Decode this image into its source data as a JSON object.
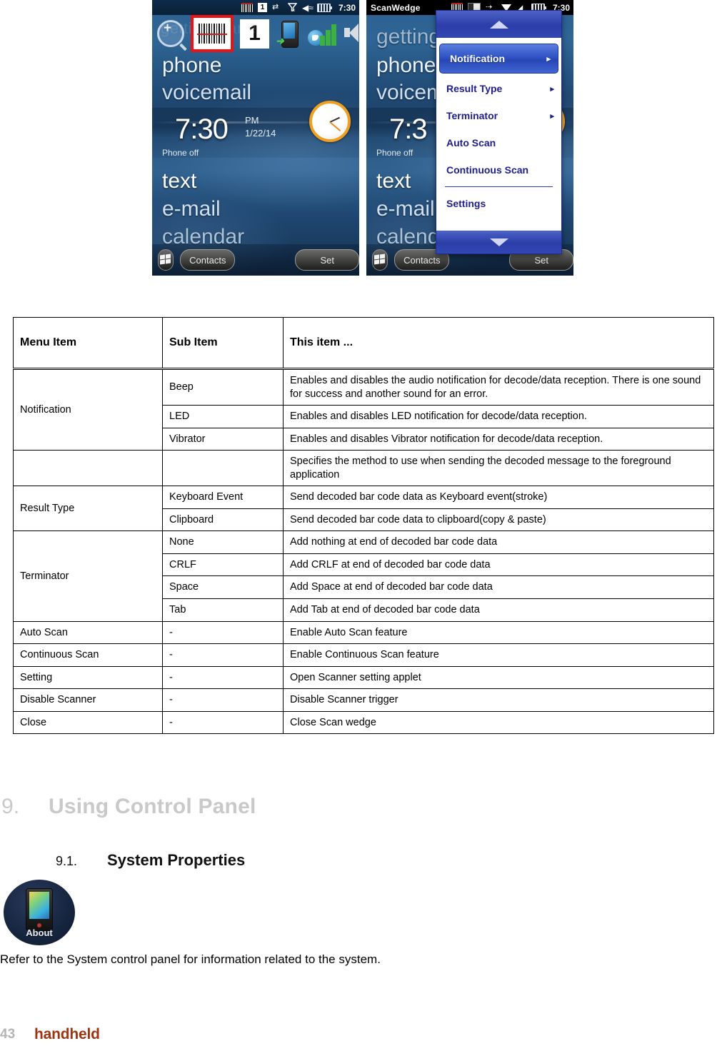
{
  "screens": {
    "left": {
      "status": {
        "icons": [
          "barcode-icon",
          "sim-1-icon",
          "sync-icon",
          "no-signal-icon",
          "speaker-icon",
          "battery-icon"
        ],
        "sim_label": "1",
        "time": "7:30"
      },
      "ghost_text": "getting started",
      "icon_row": [
        "magnifier-icon",
        "barcode-icon",
        "tile-1",
        "phone-sync-icon",
        "signal-icon",
        "speaker-icon"
      ],
      "tile_number": "1",
      "rows": {
        "phone": "phone",
        "voicemail": "voicemail",
        "text": "text",
        "email": "e-mail",
        "calendar": "calendar"
      },
      "clock": {
        "time": "7:30",
        "ampm": "PM",
        "date": "1/22/14",
        "phone_state": "Phone off"
      },
      "softkeys": {
        "left": "Contacts",
        "right": "Set"
      }
    },
    "right": {
      "title": "ScanWedge",
      "status": {
        "icons": [
          "barcode-icon",
          "sim-icon",
          "sync-icon",
          "triangle-icon",
          "signal-icon",
          "battery-icon"
        ],
        "time": "7:30"
      },
      "rows": {
        "getting": "getting",
        "phone": "phone",
        "voicemail": "voicem",
        "text": "text",
        "email": "e-mail",
        "calendar": "calend"
      },
      "clock": {
        "time": "7:3",
        "phone_state": "Phone off"
      },
      "softkeys": {
        "left": "Contacts",
        "right": "Set"
      },
      "menu": {
        "scroll_up": "chevron-up-icon",
        "scroll_down": "chevron-down-icon",
        "items": [
          {
            "label": "Notification",
            "has_submenu": true,
            "selected": true
          },
          {
            "label": "Result Type",
            "has_submenu": true,
            "selected": false
          },
          {
            "label": "Terminator",
            "has_submenu": true,
            "selected": false
          },
          {
            "label": "Auto Scan",
            "has_submenu": false,
            "selected": false
          },
          {
            "label": "Continuous Scan",
            "has_submenu": false,
            "selected": false
          },
          {
            "label": "Settings",
            "has_submenu": false,
            "selected": false,
            "separator_before": true
          }
        ]
      }
    }
  },
  "table": {
    "headers": [
      "Menu Item",
      "Sub Item",
      "This item ..."
    ],
    "rows": [
      {
        "menu": "Notification",
        "menu_rowspan": 3,
        "sub": "Beep",
        "desc": "Enables and disables the audio notification for decode/data reception. There is one sound for success and another sound for an error."
      },
      {
        "sub": "LED",
        "desc": "Enables and disables LED notification for decode/data reception."
      },
      {
        "sub": "Vibrator",
        "desc": "Enables and disables Vibrator notification for decode/data reception."
      },
      {
        "menu": "",
        "sub": "",
        "desc": "Specifies the method to use when sending the decoded message to the foreground application"
      },
      {
        "menu": "Result Type",
        "menu_rowspan": 2,
        "sub": "Keyboard Event",
        "desc": "Send decoded bar code data as Keyboard event(stroke)"
      },
      {
        "sub": "Clipboard",
        "desc": "Send decoded bar code data to clipboard(copy & paste)"
      },
      {
        "menu": "Terminator",
        "menu_rowspan": 4,
        "sub": "None",
        "desc": "Add nothing at end of decoded bar code data"
      },
      {
        "sub": "CRLF",
        "desc": "Add CRLF at end of decoded bar code data"
      },
      {
        "sub": "Space",
        "desc": "Add Space at end of decoded bar code data"
      },
      {
        "sub": "Tab",
        "desc": "Add Tab at end of decoded bar code data"
      },
      {
        "menu": "Auto Scan",
        "sub": "-",
        "desc": "Enable Auto Scan feature"
      },
      {
        "menu": "Continuous Scan",
        "sub": "-",
        "desc": "Enable Continuous Scan feature"
      },
      {
        "menu": "Setting",
        "sub": "-",
        "desc": "Open Scanner setting applet"
      },
      {
        "menu": "Disable Scanner",
        "sub": "-",
        "desc": "Disable Scanner trigger"
      },
      {
        "menu": "Close",
        "sub": "-",
        "desc": "Close Scan wedge"
      }
    ]
  },
  "content": {
    "h1_number": "9.",
    "h1_title": "Using Control Panel",
    "h2_number": "9.1.",
    "h2_title": "System Properties",
    "about_icon_label": "About",
    "paragraph": "Refer to the System control panel for information related to the system."
  },
  "footer": {
    "page_number": "43",
    "brand": "handheld"
  },
  "colors": {
    "heading_gray": "#c9c9c9",
    "brand_red": "#9d3613",
    "menu_blue": "#2b3da8",
    "highlight_red": "#ee1111"
  }
}
